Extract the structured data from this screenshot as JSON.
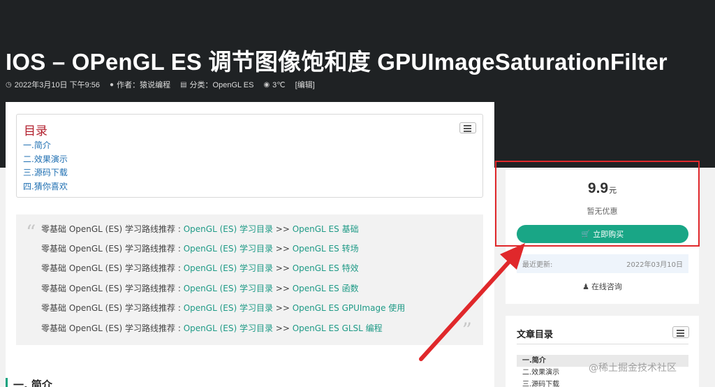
{
  "article": {
    "title": "IOS  –  OPenGL ES 调节图像饱和度 GPUImageSaturationFilter",
    "meta": {
      "date": "2022年3月10日 下午9:56",
      "author": "作者：猿说编程",
      "category": "分类：OpenGL ES",
      "views": "3℃",
      "edit": "[编辑]"
    }
  },
  "toc": {
    "title": "目录",
    "items": [
      "一.简介",
      "二.效果演示",
      "三.源码下载",
      "四.猜你喜欢"
    ]
  },
  "quote": {
    "prefix": "零基础 OpenGL (ES) 学习路线推荐 : ",
    "catalog_link": "OpenGL (ES) 学习目录",
    "separator": " >> ",
    "links": [
      "OpenGL ES 基础",
      "OpenGL ES 转场",
      "OpenGL ES 特效",
      "OpenGL ES 函数",
      "OpenGL ES GPUImage 使用",
      "OpenGL ES GLSL 编程"
    ]
  },
  "section": {
    "heading": "一. 简介"
  },
  "purchase": {
    "price": "9.9",
    "unit": "元",
    "discount": "暂无优惠",
    "buy_label": "立即购买",
    "update_label": "最近更新:",
    "update_date": "2022年03月10日",
    "consult_label": "在线咨询"
  },
  "sidebar_toc": {
    "title": "文章目录",
    "items": [
      "一.简介",
      "二.效果演示",
      "三.源码下载"
    ]
  },
  "watermark": "@稀土掘金技术社区",
  "colors": {
    "accent": "#19a686",
    "link": "#1e9a86",
    "toc_title": "#b21f2d",
    "highlight": "#e0282b"
  },
  "icons": {
    "date": "clock-icon",
    "author": "user-icon",
    "category": "folder-icon",
    "views": "eye-icon",
    "cart": "cart-icon",
    "consult": "qq-icon",
    "annotation": "red-arrow"
  }
}
